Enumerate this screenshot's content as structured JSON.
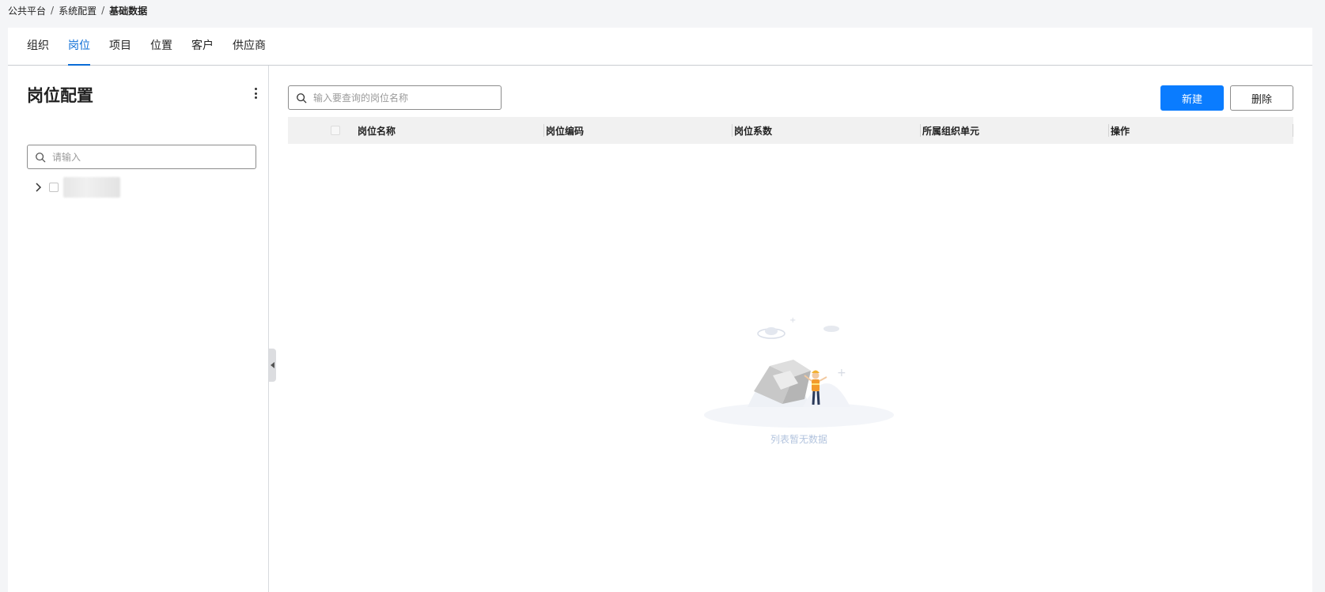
{
  "breadcrumb": {
    "items": [
      "公共平台",
      "系统配置",
      "基础数据"
    ],
    "separator": "/"
  },
  "tabs": [
    {
      "label": "组织",
      "active": false
    },
    {
      "label": "岗位",
      "active": true
    },
    {
      "label": "项目",
      "active": false
    },
    {
      "label": "位置",
      "active": false
    },
    {
      "label": "客户",
      "active": false
    },
    {
      "label": "供应商",
      "active": false
    }
  ],
  "left_panel": {
    "title": "岗位配置",
    "search_placeholder": "请输入",
    "more_icon": "more-vertical-icon"
  },
  "main": {
    "search_placeholder": "输入要查询的岗位名称",
    "new_button": "新建",
    "delete_button": "删除",
    "columns": [
      "岗位名称",
      "岗位编码",
      "岗位系数",
      "所属组织单元",
      "操作"
    ],
    "rows": [],
    "empty_text": "列表暂无数据"
  },
  "colors": {
    "accent": "#0a7cff",
    "tab_active": "#0a6cd6",
    "empty_text": "#b3c4de"
  }
}
